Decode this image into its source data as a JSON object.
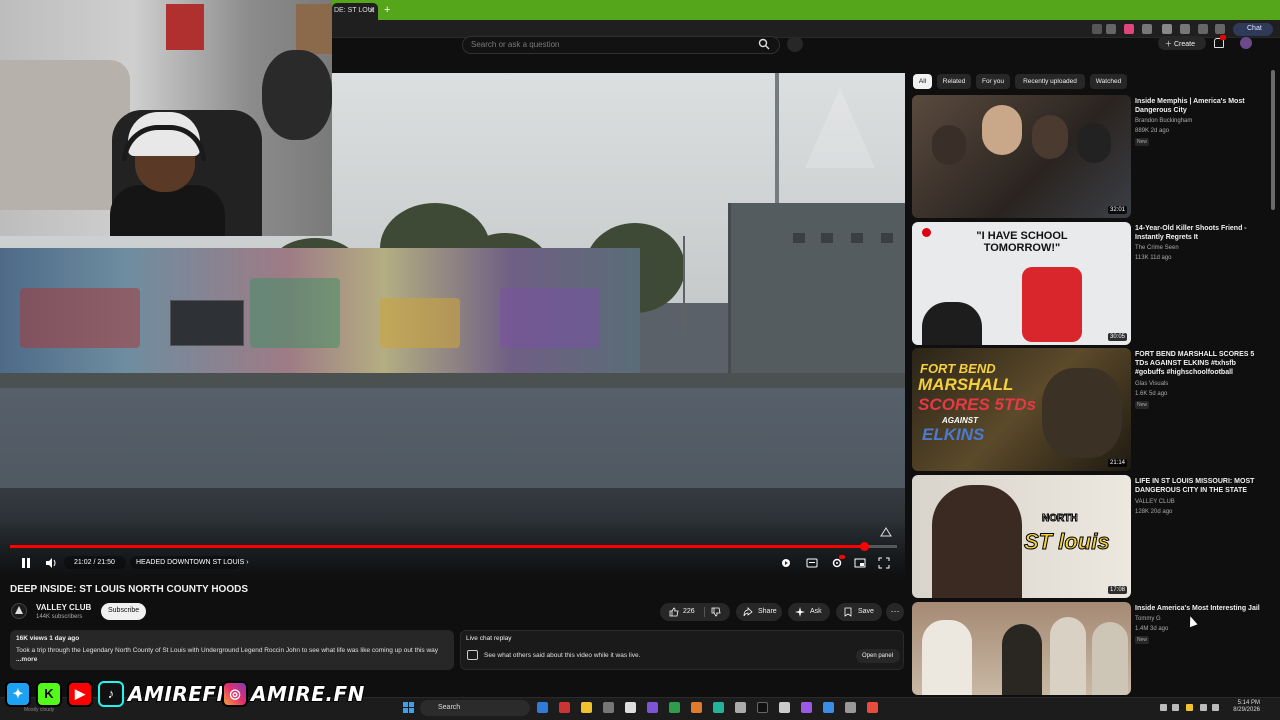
{
  "browser": {
    "tab_title": "DE: ST LOUI",
    "tab_close": "✕",
    "new_tab": "+",
    "chat_label": "Chat"
  },
  "header": {
    "search_placeholder": "Search or ask a question",
    "create_label": "Create"
  },
  "player": {
    "time": "21:02 / 21:50",
    "chapter": "HEADED DOWNTOWN ST LOUIS",
    "chapter_chevron": "›",
    "progress": 0.963
  },
  "video": {
    "title": "DEEP INSIDE: ST LOUIS NORTH COUNTY HOODS",
    "channel_name": "VALLEY CLUB",
    "channel_subs": "144K subscribers",
    "subscribe_label": "Subscribe",
    "likes": "226",
    "share_label": "Share",
    "ask_label": "Ask",
    "save_label": "Save",
    "more_label": "···"
  },
  "description": {
    "meta": "16K views  1 day ago",
    "text": "Took a trip through the Legendary North County of St Louis with Underground Legend Roccin John to see what life was like coming up out this way",
    "more": "...more"
  },
  "live_chat": {
    "title": "Live chat replay",
    "desc": "See what others said about this video while it was live.",
    "open_label": "Open panel"
  },
  "sidebar": {
    "chips": [
      "All",
      "Related",
      "For you",
      "Recently uploaded",
      "Watched"
    ],
    "recommendations": [
      {
        "title": "Inside Memphis | America's Most Dangerous City",
        "channel": "Brandon Buckingham",
        "meta": "889K  2d ago",
        "new": "New",
        "duration": "32:01"
      },
      {
        "title": "14-Year-Old Killer Shoots Friend - Instantly Regrets It",
        "channel": "The Crime Seen",
        "meta": "113K  11d ago",
        "new": "",
        "duration": "30:05",
        "thumb_text": "\"I HAVE SCHOOL TOMORROW!\""
      },
      {
        "title": "FORT BEND MARSHALL SCORES 5 TDs AGAINST ELKINS #txhsfb #gobuffs #highschoolfootball",
        "channel": "Glas Visuals",
        "meta": "1.6K  5d ago",
        "new": "New",
        "duration": "21:14",
        "thumb_line1": "FORT BEND",
        "thumb_line2": "MARSHALL",
        "thumb_line3": "SCORES 5TDs",
        "thumb_line4": "AGAINST",
        "thumb_line5": "ELKINS"
      },
      {
        "title": "LIFE IN ST LOUIS MISSOURI: MOST DANGEROUS CITY IN THE STATE",
        "channel": "VALLEY CLUB",
        "meta": "128K  20d ago",
        "new": "",
        "duration": "17:08",
        "thumb_line1": "NORTH",
        "thumb_line2": "ST louis"
      },
      {
        "title": "Inside America's Most Interesting Jail",
        "channel": "Tommy G",
        "meta": "1.4M  3d ago",
        "new": "New",
        "duration": ""
      }
    ]
  },
  "taskbar": {
    "search_label": "Search",
    "time": "5:14 PM",
    "date": "8/29/2026"
  },
  "overlay": {
    "handle1": "AMIREFN",
    "handle2": "AMIRE.FN",
    "tag": "Mostly cloudy"
  },
  "colors": {
    "accent_red": "#ff0000",
    "browser_green": "#55a61b",
    "background": "#0f0f0f"
  }
}
